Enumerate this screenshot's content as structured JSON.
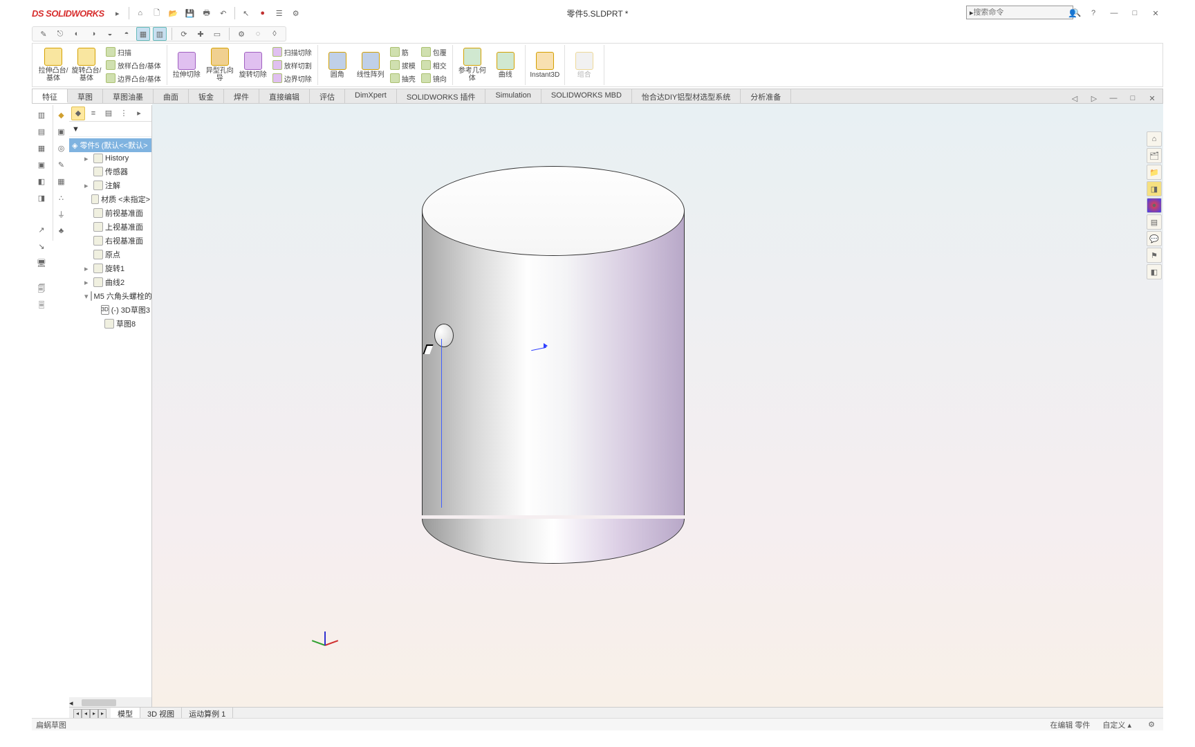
{
  "app": {
    "name": "SOLIDWORKS",
    "doc_title": "零件5.SLDPRT *"
  },
  "search": {
    "placeholder": "搜索命令"
  },
  "window": {
    "user_tip": "?",
    "min": "—",
    "max": "□",
    "close": "✕"
  },
  "ribbon": {
    "big": {
      "extrude_boss": "拉伸凸台/基体",
      "revolve_boss": "旋转凸台/基体",
      "extrude_cut": "拉伸切除",
      "hole_wizard": "异型孔向导",
      "revolve_cut": "旋转切除",
      "fillet": "圆角",
      "linear_pattern": "线性阵列",
      "ref_geom": "参考几何体",
      "curves": "曲线",
      "instant3d": "Instant3D",
      "combine": "组合"
    },
    "small": {
      "sweep": "扫描",
      "loft_boss": "放样凸台/基体",
      "boundary_boss": "边界凸台/基体",
      "sweep_cut": "扫描切除",
      "loft_cut": "放样切割",
      "boundary_cut": "边界切除",
      "rib": "筋",
      "draft": "拔模",
      "shell": "抽壳",
      "wrap": "包覆",
      "intersect": "相交",
      "mirror": "镜向"
    }
  },
  "tabs": [
    "特征",
    "草图",
    "草图油墨",
    "曲面",
    "钣金",
    "焊件",
    "直接编辑",
    "评估",
    "DimXpert",
    "SOLIDWORKS 插件",
    "Simulation",
    "SOLIDWORKS MBD",
    "怡合达DIY铝型材选型系统",
    "分析准备"
  ],
  "active_tab": "特征",
  "tree": {
    "root": "零件5  (默认<<默认>",
    "items": [
      {
        "label": "History",
        "l": 2,
        "exp": "▸"
      },
      {
        "label": "传感器",
        "l": 2
      },
      {
        "label": "注解",
        "l": 2,
        "exp": "▸"
      },
      {
        "label": "材质 <未指定>",
        "l": 2
      },
      {
        "label": "前视基准面",
        "l": 2
      },
      {
        "label": "上视基准面",
        "l": 2
      },
      {
        "label": "右视基准面",
        "l": 2
      },
      {
        "label": "原点",
        "l": 2
      },
      {
        "label": "旋转1",
        "l": 2,
        "exp": "▸"
      },
      {
        "label": "曲线2",
        "l": 2,
        "exp": "▸"
      },
      {
        "label": "M5 六角头螺栓的",
        "l": 2,
        "exp": "▾"
      },
      {
        "label": "(-) 3D草图3",
        "l": 3,
        "tag": "3D"
      },
      {
        "label": "草图8",
        "l": 3
      }
    ]
  },
  "bottom_tabs": [
    "模型",
    "3D 视图",
    "运动算例 1"
  ],
  "active_bottom_tab": "模型",
  "status": {
    "left": "扁蜗草图",
    "mode": "在编辑 零件",
    "units": "自定义",
    "arrow": "▴"
  }
}
